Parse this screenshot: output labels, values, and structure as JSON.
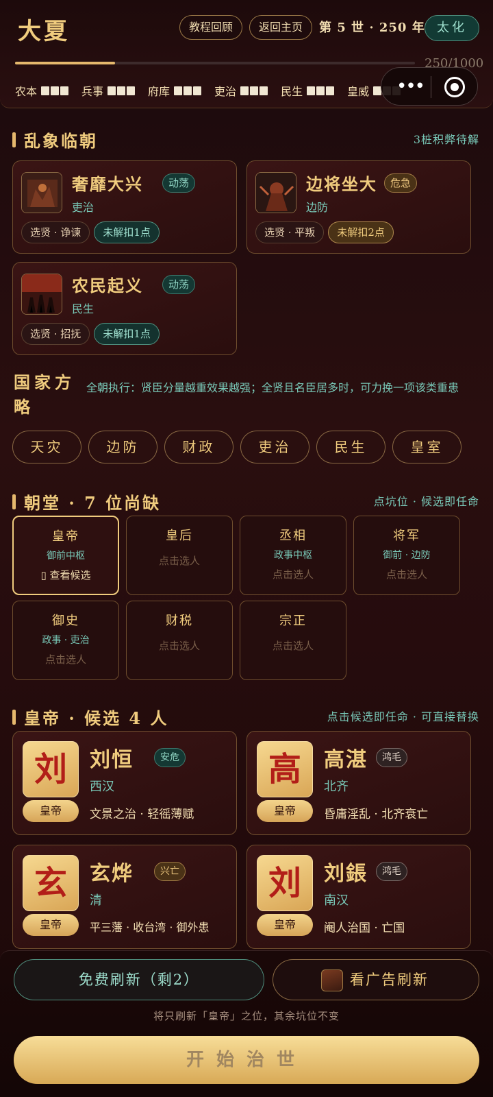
{
  "header": {
    "dynasty": "大夏",
    "tutorial_label": "教程回顾",
    "home_label": "返回主页",
    "era": "第 5 世 · 250 年",
    "reign_label": "太化",
    "progress_text": "250/1000",
    "progress_fraction": 0.25,
    "stats": [
      {
        "label": "农本",
        "level": 3
      },
      {
        "label": "兵事",
        "level": 3
      },
      {
        "label": "府库",
        "level": 3
      },
      {
        "label": "吏治",
        "level": 3
      },
      {
        "label": "民生",
        "level": 3
      },
      {
        "label": "皇威",
        "level": 3
      }
    ]
  },
  "crisis_section": {
    "title": "乱象临朝",
    "right_text": "3桩积弊待解",
    "cards": [
      {
        "title": "奢靡大兴",
        "tag": "动荡",
        "category": "吏治",
        "action": "选贤 · 诤谏",
        "status": "未解扣1点"
      },
      {
        "title": "边将坐大",
        "tag": "危急",
        "category": "边防",
        "action": "选贤 · 平叛",
        "status": "未解扣2点"
      },
      {
        "title": "农民起义",
        "tag": "动荡",
        "category": "民生",
        "action": "选贤 · 招抚",
        "status": "未解扣1点"
      }
    ]
  },
  "strategy": {
    "label": "国家方略",
    "description": "全朝执行：贤臣分量越重效果越强；全贤且名臣居多时，可力挽一项该类重患",
    "options": [
      "天灾",
      "边防",
      "财政",
      "吏治",
      "民生",
      "皇室"
    ]
  },
  "court_section": {
    "title": "朝堂 · 7 位尚缺",
    "right_text": "点坑位 · 候选即任命",
    "view_label": "查看候选",
    "pick_label": "点击选人",
    "slots": [
      {
        "name": "皇帝",
        "desc": "御前中枢"
      },
      {
        "name": "皇后",
        "desc": ""
      },
      {
        "name": "丞相",
        "desc": "政事中枢"
      },
      {
        "name": "将军",
        "desc": "御前 · 边防"
      },
      {
        "name": "御史",
        "desc": "政事 · 吏治"
      },
      {
        "name": "财税",
        "desc": ""
      },
      {
        "name": "宗正",
        "desc": ""
      }
    ]
  },
  "candidate_section": {
    "title": "皇帝 · 候选 4 人",
    "right_text": "点击候选即任命 · 可直接替换",
    "candidates": [
      {
        "seal": "刘",
        "role": "皇帝",
        "name": "刘恒",
        "tag": "安危",
        "dynasty": "西汉",
        "deeds": "文景之治 · 轻徭薄赋"
      },
      {
        "seal": "高",
        "role": "皇帝",
        "name": "高湛",
        "tag": "鸿毛",
        "dynasty": "北齐",
        "deeds": "昏庸淫乱 · 北齐衰亡"
      },
      {
        "seal": "玄",
        "role": "皇帝",
        "name": "玄烨",
        "tag": "兴亡",
        "dynasty": "清",
        "deeds": "平三藩 · 收台湾 · 御外患"
      },
      {
        "seal": "刘",
        "role": "皇帝",
        "name": "刘鋹",
        "tag": "鸿毛",
        "dynasty": "南汉",
        "deeds": "阉人治国 · 亡国"
      }
    ]
  },
  "bottom": {
    "free_refresh": "免费刷新（剩2）",
    "ad_refresh": "看广告刷新",
    "note": "将只刷新「皇帝」之位，其余坑位不变",
    "start": "开始治世"
  }
}
